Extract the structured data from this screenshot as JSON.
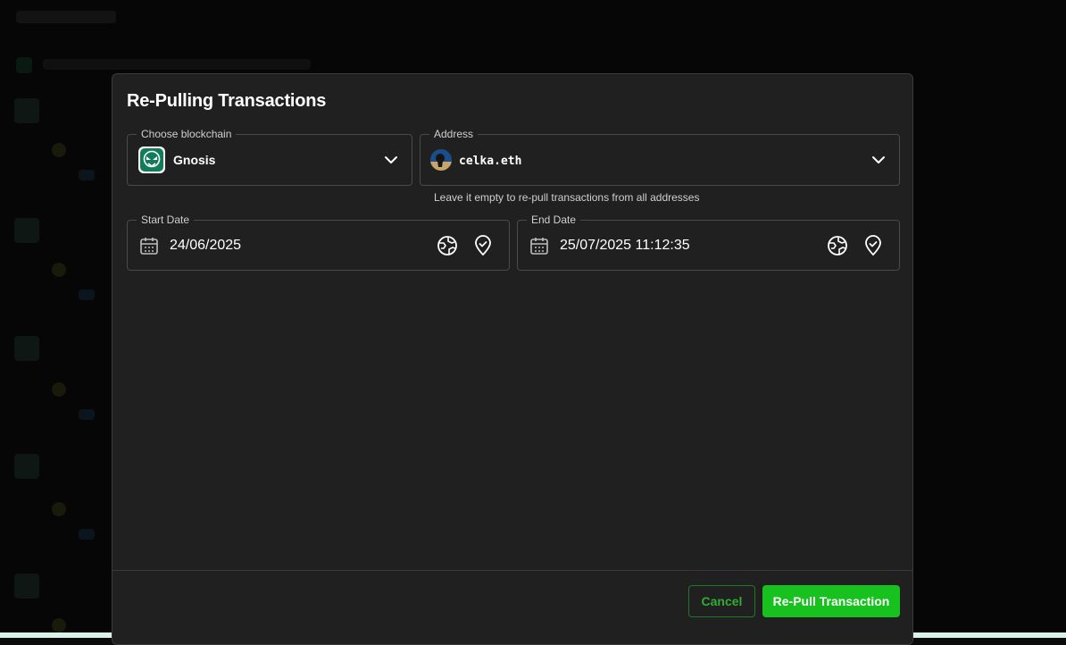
{
  "dialog": {
    "title": "Re-Pulling Transactions"
  },
  "blockchain": {
    "legend": "Choose blockchain",
    "selected": "Gnosis",
    "icon": "gnosis-owl-icon"
  },
  "address": {
    "legend": "Address",
    "selected": "celka.eth",
    "helper": "Leave it empty to re-pull transactions from all addresses"
  },
  "start_date": {
    "legend": "Start Date",
    "value": "24/06/2025"
  },
  "end_date": {
    "legend": "End Date",
    "value": "25/07/2025 11:12:35"
  },
  "actions": {
    "cancel_label": "Cancel",
    "submit_label": "Re-Pull Transaction"
  },
  "colors": {
    "accent": "#17c21f",
    "gnosis": "#127c5a",
    "dialog_bg": "#202020"
  }
}
